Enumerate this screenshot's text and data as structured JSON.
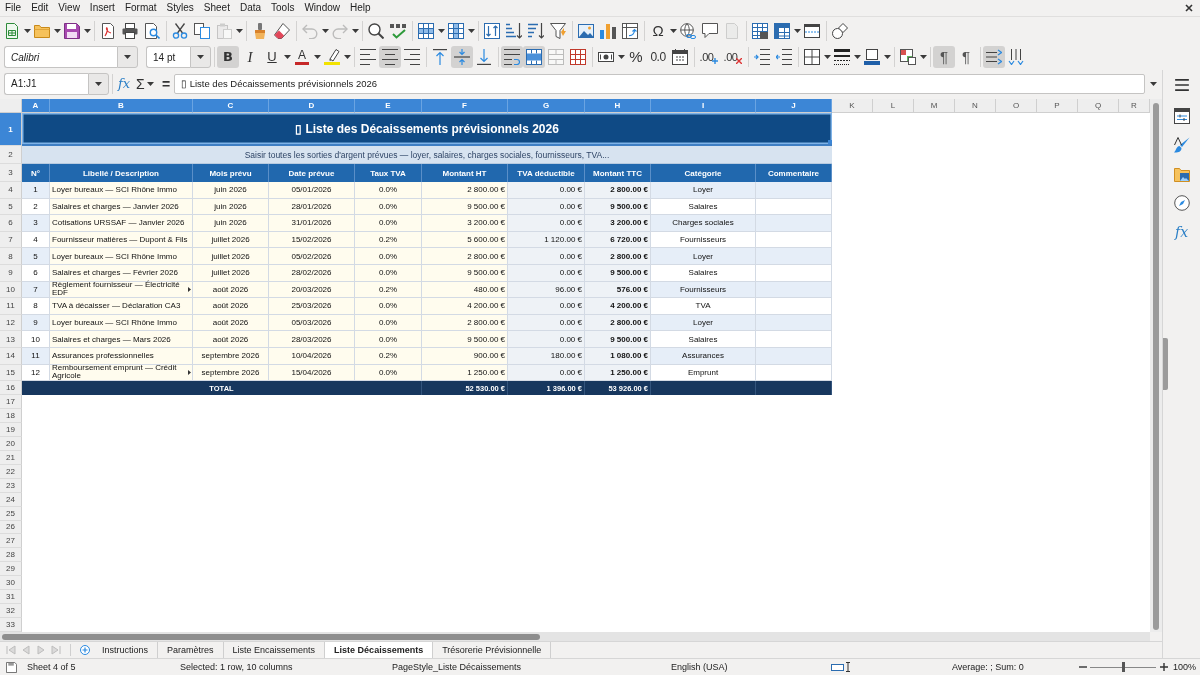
{
  "menu_bar": {
    "items": [
      "File",
      "Edit",
      "View",
      "Insert",
      "Format",
      "Styles",
      "Sheet",
      "Data",
      "Tools",
      "Window",
      "Help"
    ]
  },
  "standard_toolbar": {
    "groups": [
      [
        {
          "kind": "new",
          "dropdown": true,
          "disabled": false
        },
        {
          "kind": "open",
          "dropdown": true,
          "disabled": false
        },
        {
          "kind": "save",
          "dropdown": true,
          "disabled": false
        }
      ],
      [
        {
          "kind": "export_pdf",
          "dropdown": false,
          "disabled": false
        },
        {
          "kind": "print",
          "dropdown": false,
          "disabled": false
        },
        {
          "kind": "print_preview",
          "dropdown": false,
          "disabled": false
        }
      ],
      [
        {
          "kind": "cut",
          "dropdown": false,
          "disabled": false
        },
        {
          "kind": "copy",
          "dropdown": false,
          "disabled": false
        },
        {
          "kind": "paste",
          "dropdown": true,
          "disabled": true
        }
      ],
      [
        {
          "kind": "clone_formatting",
          "dropdown": false,
          "disabled": false
        },
        {
          "kind": "clear_formatting",
          "dropdown": false,
          "disabled": false
        }
      ],
      [
        {
          "kind": "undo",
          "dropdown": true,
          "disabled": true
        },
        {
          "kind": "redo",
          "dropdown": true,
          "disabled": true
        }
      ],
      [
        {
          "kind": "find_replace",
          "dropdown": false,
          "disabled": false
        },
        {
          "kind": "spelling",
          "dropdown": false,
          "disabled": false
        }
      ],
      [
        {
          "kind": "row",
          "dropdown": true,
          "disabled": false
        },
        {
          "kind": "column",
          "dropdown": true,
          "disabled": false
        }
      ],
      [
        {
          "kind": "sort",
          "dropdown": false,
          "disabled": false
        },
        {
          "kind": "sort_ascending",
          "dropdown": false,
          "disabled": false
        },
        {
          "kind": "sort_descending",
          "dropdown": false,
          "disabled": false
        },
        {
          "kind": "autofilter",
          "dropdown": false,
          "disabled": false
        }
      ],
      [
        {
          "kind": "image",
          "dropdown": false,
          "disabled": false
        },
        {
          "kind": "chart",
          "dropdown": false,
          "disabled": false
        },
        {
          "kind": "pivot_table",
          "dropdown": false,
          "disabled": false
        }
      ],
      [
        {
          "kind": "special_character",
          "glyph": "Ω",
          "dropdown": true,
          "disabled": false
        },
        {
          "kind": "hyperlink",
          "dropdown": false,
          "disabled": false
        },
        {
          "kind": "comment",
          "dropdown": false,
          "disabled": false
        },
        {
          "kind": "headers_footers",
          "dropdown": false,
          "disabled": true
        }
      ],
      [
        {
          "kind": "print_area",
          "dropdown": false,
          "disabled": false
        },
        {
          "kind": "freeze",
          "dropdown": true,
          "disabled": false
        },
        {
          "kind": "split_window",
          "dropdown": false,
          "disabled": false
        }
      ],
      [
        {
          "kind": "shapes",
          "dropdown": false,
          "disabled": false
        }
      ]
    ]
  },
  "formatting_toolbar": {
    "font_name": "Calibri",
    "font_size": "14 pt",
    "groups": [
      [
        {
          "kind": "bold",
          "glyph": "B",
          "pressed": true,
          "dropdown": false,
          "disabled": false
        },
        {
          "kind": "italic",
          "glyph": "I",
          "pressed": false,
          "dropdown": false,
          "disabled": false
        },
        {
          "kind": "underline",
          "glyph": "U",
          "pressed": false,
          "dropdown": true,
          "disabled": false
        },
        {
          "kind": "font_color",
          "glyph": "A",
          "pressed": false,
          "dropdown": true,
          "disabled": false
        },
        {
          "kind": "highlighting",
          "pressed": false,
          "dropdown": true,
          "disabled": false
        }
      ],
      [
        {
          "kind": "align_left",
          "pressed": false,
          "dropdown": false,
          "disabled": false
        },
        {
          "kind": "align_center",
          "pressed": true,
          "dropdown": false,
          "disabled": false
        },
        {
          "kind": "align_right",
          "pressed": false,
          "dropdown": false,
          "disabled": false
        }
      ],
      [
        {
          "kind": "align_top",
          "pressed": false,
          "dropdown": false,
          "disabled": false
        },
        {
          "kind": "align_middle",
          "pressed": true,
          "dropdown": false,
          "disabled": false
        },
        {
          "kind": "align_bottom",
          "pressed": false,
          "dropdown": false,
          "disabled": false
        }
      ],
      [
        {
          "kind": "wrap_text",
          "pressed": true,
          "dropdown": false,
          "disabled": false
        },
        {
          "kind": "merge_center",
          "pressed": true,
          "dropdown": false,
          "disabled": false
        },
        {
          "kind": "merge_cells",
          "pressed": false,
          "dropdown": false,
          "disabled": true
        },
        {
          "kind": "unmerge_cells",
          "pressed": false,
          "dropdown": false,
          "disabled": false
        }
      ],
      [
        {
          "kind": "currency",
          "pressed": false,
          "dropdown": true,
          "disabled": false
        },
        {
          "kind": "percent",
          "glyph": "%",
          "pressed": false,
          "dropdown": false,
          "disabled": false
        },
        {
          "kind": "number",
          "glyph": "0.0",
          "pressed": false,
          "dropdown": false,
          "disabled": false
        },
        {
          "kind": "date",
          "pressed": false,
          "dropdown": false,
          "disabled": false
        }
      ],
      [
        {
          "kind": "add_decimal",
          "glyph": ".00",
          "pressed": false,
          "dropdown": false,
          "disabled": false
        },
        {
          "kind": "delete_decimal",
          "glyph": ".00",
          "pressed": false,
          "dropdown": false,
          "disabled": false
        }
      ],
      [
        {
          "kind": "increase_indent",
          "pressed": false,
          "dropdown": false,
          "disabled": false
        },
        {
          "kind": "decrease_indent",
          "pressed": false,
          "dropdown": false,
          "disabled": false
        }
      ],
      [
        {
          "kind": "borders",
          "pressed": false,
          "dropdown": true,
          "disabled": false
        },
        {
          "kind": "border_style",
          "pressed": false,
          "dropdown": true,
          "disabled": false
        },
        {
          "kind": "border_color",
          "pressed": false,
          "dropdown": true,
          "disabled": false
        }
      ],
      [
        {
          "kind": "conditional",
          "pressed": false,
          "dropdown": true,
          "disabled": false
        }
      ],
      [
        {
          "kind": "left_to_right",
          "glyph": "¶",
          "pressed": true,
          "dropdown": false,
          "disabled": false
        },
        {
          "kind": "right_to_left",
          "glyph": "¶",
          "pressed": false,
          "dropdown": false,
          "disabled": false
        }
      ],
      [
        {
          "kind": "text_direction",
          "pressed": true,
          "dropdown": false,
          "disabled": false
        },
        {
          "kind": "vertical_text",
          "pressed": false,
          "dropdown": false,
          "disabled": false
        }
      ]
    ]
  },
  "formula_bar": {
    "name_box": "A1:J1",
    "function_wizard": "fx",
    "autosum": "Σ",
    "formula": "=",
    "content": "▯ Liste des Décaissements prévisionnels 2026"
  },
  "sheet": {
    "column_headers": [
      {
        "label": "A",
        "selected": true
      },
      {
        "label": "B",
        "selected": true
      },
      {
        "label": "C",
        "selected": true
      },
      {
        "label": "D",
        "selected": true
      },
      {
        "label": "E",
        "selected": true
      },
      {
        "label": "F",
        "selected": true
      },
      {
        "label": "G",
        "selected": true
      },
      {
        "label": "H",
        "selected": true
      },
      {
        "label": "I",
        "selected": true
      },
      {
        "label": "J",
        "selected": true
      },
      {
        "label": "K",
        "selected": false
      },
      {
        "label": "L",
        "selected": false
      },
      {
        "label": "M",
        "selected": false
      },
      {
        "label": "N",
        "selected": false
      },
      {
        "label": "O",
        "selected": false
      },
      {
        "label": "P",
        "selected": false
      },
      {
        "label": "Q",
        "selected": false
      },
      {
        "label": "R",
        "selected": false
      }
    ],
    "row_headers": [
      {
        "label": "1",
        "selected": true
      },
      {
        "label": "2",
        "selected": false
      },
      {
        "label": "3",
        "selected": false
      },
      {
        "label": "4",
        "selected": false
      },
      {
        "label": "5",
        "selected": false
      },
      {
        "label": "6",
        "selected": false
      },
      {
        "label": "7",
        "selected": false
      },
      {
        "label": "8",
        "selected": false
      },
      {
        "label": "9",
        "selected": false
      },
      {
        "label": "10",
        "selected": false
      },
      {
        "label": "11",
        "selected": false
      },
      {
        "label": "12",
        "selected": false
      },
      {
        "label": "13",
        "selected": false
      },
      {
        "label": "14",
        "selected": false
      },
      {
        "label": "15",
        "selected": false
      },
      {
        "label": "16",
        "selected": false
      },
      {
        "label": "17",
        "selected": false
      },
      {
        "label": "18",
        "selected": false
      },
      {
        "label": "19",
        "selected": false
      },
      {
        "label": "20",
        "selected": false
      },
      {
        "label": "21",
        "selected": false
      },
      {
        "label": "22",
        "selected": false
      },
      {
        "label": "23",
        "selected": false
      },
      {
        "label": "24",
        "selected": false
      },
      {
        "label": "25",
        "selected": false
      },
      {
        "label": "26",
        "selected": false
      },
      {
        "label": "27",
        "selected": false
      },
      {
        "label": "28",
        "selected": false
      },
      {
        "label": "29",
        "selected": false
      },
      {
        "label": "30",
        "selected": false
      },
      {
        "label": "31",
        "selected": false
      },
      {
        "label": "32",
        "selected": false
      },
      {
        "label": "33",
        "selected": false
      }
    ],
    "title": {
      "text": "▯ Liste des Décaissements prévisionnels 2026",
      "selected": true
    },
    "subtitle": "Saisir toutes les sorties d'argent prévues — loyer, salaires, charges sociales, fournisseurs, TVA...",
    "table": {
      "columns": [
        "N°",
        "Libellé / Description",
        "Mois prévu",
        "Date prévue",
        "Taux TVA",
        "Montant HT",
        "TVA déductible",
        "Montant TTC",
        "Catégorie",
        "Commentaire"
      ],
      "rows": [
        {
          "number": "1",
          "description": "Loyer bureaux — SCI Rhône Immo",
          "month": "juin 2026",
          "date": "05/01/2026",
          "vat_rate": "0.0%",
          "amount_ht": "2 800.00 €",
          "vat_deductible": "0.00 €",
          "amount_ttc": "2 800.00 €",
          "category": "Loyer",
          "description_overflows": false
        },
        {
          "number": "2",
          "description": "Salaires et charges — Janvier 2026",
          "month": "juin 2026",
          "date": "28/01/2026",
          "vat_rate": "0.0%",
          "amount_ht": "9 500.00 €",
          "vat_deductible": "0.00 €",
          "amount_ttc": "9 500.00 €",
          "category": "Salaires",
          "description_overflows": false
        },
        {
          "number": "3",
          "description": "Cotisations URSSAF — Janvier 2026",
          "month": "juin 2026",
          "date": "31/01/2026",
          "vat_rate": "0.0%",
          "amount_ht": "3 200.00 €",
          "vat_deductible": "0.00 €",
          "amount_ttc": "3 200.00 €",
          "category": "Charges sociales",
          "description_overflows": false
        },
        {
          "number": "4",
          "description": "Fournisseur matières — Dupont & Fils",
          "month": "juillet 2026",
          "date": "15/02/2026",
          "vat_rate": "0.2%",
          "amount_ht": "5 600.00 €",
          "vat_deductible": "1 120.00 €",
          "amount_ttc": "6 720.00 €",
          "category": "Fournisseurs",
          "description_overflows": false
        },
        {
          "number": "5",
          "description": "Loyer bureaux — SCI Rhône Immo",
          "month": "juillet 2026",
          "date": "05/02/2026",
          "vat_rate": "0.0%",
          "amount_ht": "2 800.00 €",
          "vat_deductible": "0.00 €",
          "amount_ttc": "2 800.00 €",
          "category": "Loyer",
          "description_overflows": false
        },
        {
          "number": "6",
          "description": "Salaires et charges — Février 2026",
          "month": "juillet 2026",
          "date": "28/02/2026",
          "vat_rate": "0.0%",
          "amount_ht": "9 500.00 €",
          "vat_deductible": "0.00 €",
          "amount_ttc": "9 500.00 €",
          "category": "Salaires",
          "description_overflows": false
        },
        {
          "number": "7",
          "description": "Règlement fournisseur — Électricité EDF",
          "month": "août 2026",
          "date": "20/03/2026",
          "vat_rate": "0.2%",
          "amount_ht": "480.00 €",
          "vat_deductible": "96.00 €",
          "amount_ttc": "576.00 €",
          "category": "Fournisseurs",
          "description_overflows": true
        },
        {
          "number": "8",
          "description": "TVA à décaisser — Déclaration CA3",
          "month": "août 2026",
          "date": "25/03/2026",
          "vat_rate": "0.0%",
          "amount_ht": "4 200.00 €",
          "vat_deductible": "0.00 €",
          "amount_ttc": "4 200.00 €",
          "category": "TVA",
          "description_overflows": false
        },
        {
          "number": "9",
          "description": "Loyer bureaux — SCI Rhône Immo",
          "month": "août 2026",
          "date": "05/03/2026",
          "vat_rate": "0.0%",
          "amount_ht": "2 800.00 €",
          "vat_deductible": "0.00 €",
          "amount_ttc": "2 800.00 €",
          "category": "Loyer",
          "description_overflows": false
        },
        {
          "number": "10",
          "description": "Salaires et charges — Mars 2026",
          "month": "août 2026",
          "date": "28/03/2026",
          "vat_rate": "0.0%",
          "amount_ht": "9 500.00 €",
          "vat_deductible": "0.00 €",
          "amount_ttc": "9 500.00 €",
          "category": "Salaires",
          "description_overflows": false
        },
        {
          "number": "11",
          "description": "Assurances professionnelles",
          "month": "septembre 2026",
          "date": "10/04/2026",
          "vat_rate": "0.2%",
          "amount_ht": "900.00 €",
          "vat_deductible": "180.00 €",
          "amount_ttc": "1 080.00 €",
          "category": "Assurances",
          "description_overflows": false
        },
        {
          "number": "12",
          "description": "Remboursement emprunt — Crédit Agricole",
          "month": "septembre 2026",
          "date": "15/04/2026",
          "vat_rate": "0.0%",
          "amount_ht": "1 250.00 €",
          "vat_deductible": "0.00 €",
          "amount_ttc": "1 250.00 €",
          "category": "Emprunt",
          "description_overflows": true
        }
      ],
      "total": {
        "label": "TOTAL",
        "amount_ht": "52 530.00 €",
        "vat_deductible": "1 396.00 €",
        "amount_ttc": "53 926.00 €"
      }
    }
  },
  "sidebar": {
    "tabs": [
      {
        "kind": "menu"
      },
      {
        "kind": "properties"
      },
      {
        "kind": "styles"
      },
      {
        "kind": "gallery"
      },
      {
        "kind": "navigator"
      },
      {
        "kind": "functions",
        "glyph": "fx"
      }
    ]
  },
  "sheet_tabs": {
    "navigation": [
      {
        "kind": "first",
        "disabled": true
      },
      {
        "kind": "previous",
        "disabled": true
      },
      {
        "kind": "next",
        "disabled": true
      },
      {
        "kind": "last",
        "disabled": true
      }
    ],
    "tabs": [
      {
        "label": "Instructions",
        "selected": false
      },
      {
        "label": "Paramètres",
        "selected": false
      },
      {
        "label": "Liste Encaissements",
        "selected": false
      },
      {
        "label": "Liste Décaissements",
        "selected": true
      },
      {
        "label": "Trésorerie Prévisionnelle",
        "selected": false
      }
    ]
  },
  "status_bar": {
    "sheet_position": "Sheet 4 of 5",
    "selection": "Selected: 1 row, 10 columns",
    "page_style": "PageStyle_Liste Décaissements",
    "language": "English (USA)",
    "aggregate": "Average: ; Sum: 0",
    "zoom_slider": {
      "level": 0.5
    },
    "zoom": "100%"
  }
}
